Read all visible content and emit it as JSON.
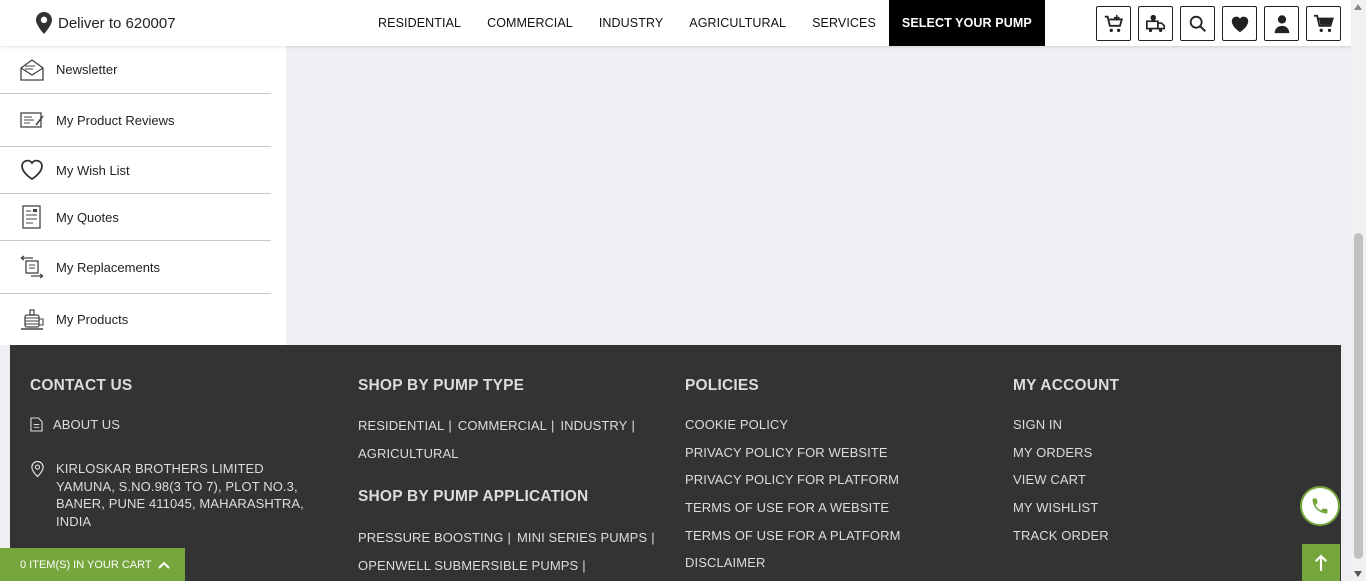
{
  "header": {
    "deliver_label": "Deliver to 620007",
    "nav": [
      "RESIDENTIAL",
      "COMMERCIAL",
      "INDUSTRY",
      "AGRICULTURAL",
      "SERVICES"
    ],
    "nav_active": "SELECT YOUR PUMP",
    "icons": [
      "bulk-order-icon",
      "track-delivery-icon",
      "search-icon",
      "wishlist-heart-icon",
      "user-account-icon",
      "cart-icon"
    ]
  },
  "sidebar": {
    "items": [
      {
        "label": "Newsletter",
        "icon": "newsletter-icon"
      },
      {
        "label": "My Product Reviews",
        "icon": "product-reviews-icon"
      },
      {
        "label": "My Wish List",
        "icon": "heart-icon"
      },
      {
        "label": "My Quotes",
        "icon": "quotes-icon"
      },
      {
        "label": "My Replacements",
        "icon": "replacements-icon"
      },
      {
        "label": "My Products",
        "icon": "products-icon"
      }
    ]
  },
  "footer": {
    "contact": {
      "heading": "CONTACT US",
      "about": "ABOUT US",
      "address": [
        "KIRLOSKAR BROTHERS LIMITED",
        "YAMUNA, S.NO.98(3 TO 7), PLOT NO.3,",
        "BANER, PUNE 411045, MAHARASHTRA,",
        "INDIA"
      ]
    },
    "pump_type": {
      "heading": "SHOP BY PUMP TYPE",
      "links": [
        "RESIDENTIAL",
        "COMMERCIAL",
        "INDUSTRY",
        "AGRICULTURAL"
      ]
    },
    "pump_application": {
      "heading": "SHOP BY PUMP APPLICATION",
      "links": [
        "PRESSURE BOOSTING",
        "MINI SERIES PUMPS",
        "OPENWELL SUBMERSIBLE PUMPS"
      ]
    },
    "policies": {
      "heading": "POLICIES",
      "links": [
        "COOKIE POLICY",
        "PRIVACY POLICY FOR WEBSITE",
        "PRIVACY POLICY FOR PLATFORM",
        "TERMS OF USE FOR A WEBSITE",
        "TERMS OF USE FOR A PLATFORM",
        "DISCLAIMER"
      ]
    },
    "account": {
      "heading": "MY ACCOUNT",
      "links": [
        "SIGN IN",
        "MY ORDERS",
        "VIEW CART",
        "MY WISHLIST",
        "TRACK ORDER"
      ]
    }
  },
  "cart_bar": {
    "label": "0 ITEM(S) IN YOUR CART"
  },
  "colors": {
    "accent_green": "#75a63c",
    "footer_bg": "#333333",
    "page_bg": "#eeeff2"
  }
}
